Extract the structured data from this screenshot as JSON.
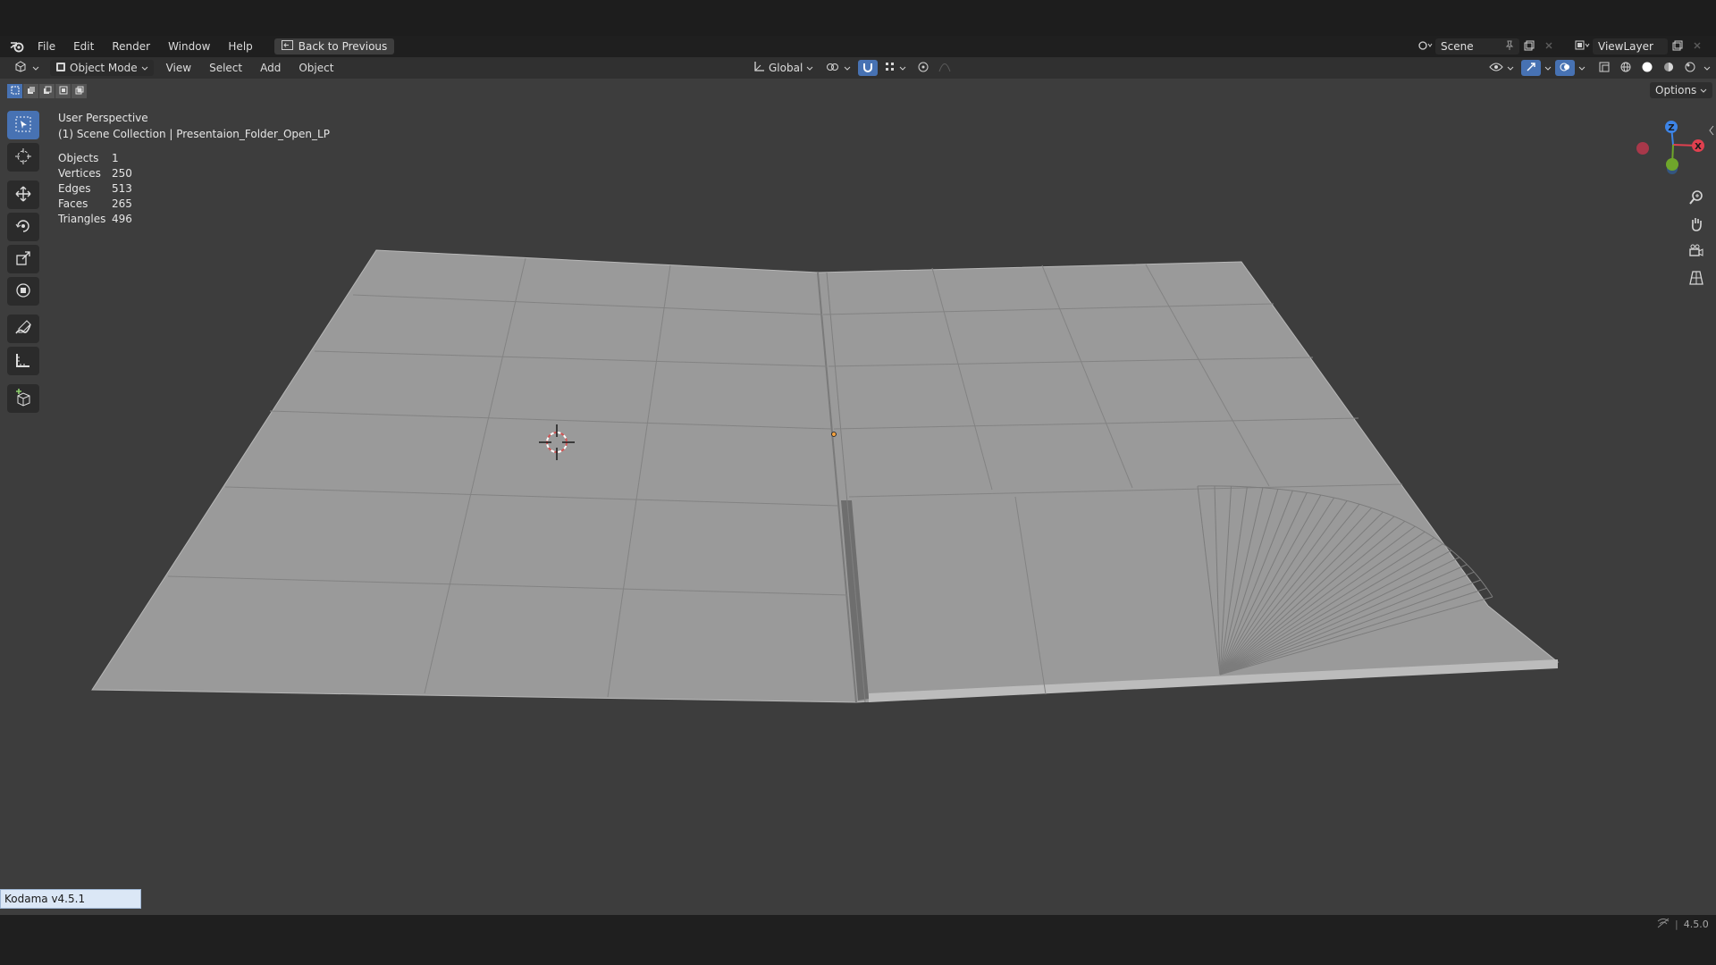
{
  "menubar": {
    "items": [
      {
        "name": "menu-file",
        "label": "File"
      },
      {
        "name": "menu-edit",
        "label": "Edit"
      },
      {
        "name": "menu-render",
        "label": "Render"
      },
      {
        "name": "menu-window",
        "label": "Window"
      },
      {
        "name": "menu-help",
        "label": "Help"
      }
    ],
    "back_button_label": "Back to Previous",
    "scene_label": "Scene",
    "viewlayer_label": "ViewLayer"
  },
  "header": {
    "mode_label": "Object Mode",
    "menus": [
      "View",
      "Select",
      "Add",
      "Object"
    ],
    "transform_orientation": "Global"
  },
  "subheader": {
    "options_label": "Options"
  },
  "viewport": {
    "perspective_label": "User Perspective",
    "collection_label": "(1) Scene Collection | Presentaion_Folder_Open_LP",
    "stats": [
      {
        "label": "Objects",
        "value": "1"
      },
      {
        "label": "Vertices",
        "value": "250"
      },
      {
        "label": "Edges",
        "value": "513"
      },
      {
        "label": "Faces",
        "value": "265"
      },
      {
        "label": "Triangles",
        "value": "496"
      }
    ]
  },
  "gizmo": {
    "z_label": "Z",
    "x_label": "X",
    "colors": {
      "x": "#e0404f",
      "y": "#6fa62b",
      "z": "#3d84e6"
    }
  },
  "statusbar": {
    "addon_label": "Kodama v4.5.1",
    "version": "4.5.0"
  },
  "theme": {
    "accent": "#4772b3",
    "viewport_bg": "#3d3d3d",
    "mesh_fill": "#9c9c9c"
  }
}
